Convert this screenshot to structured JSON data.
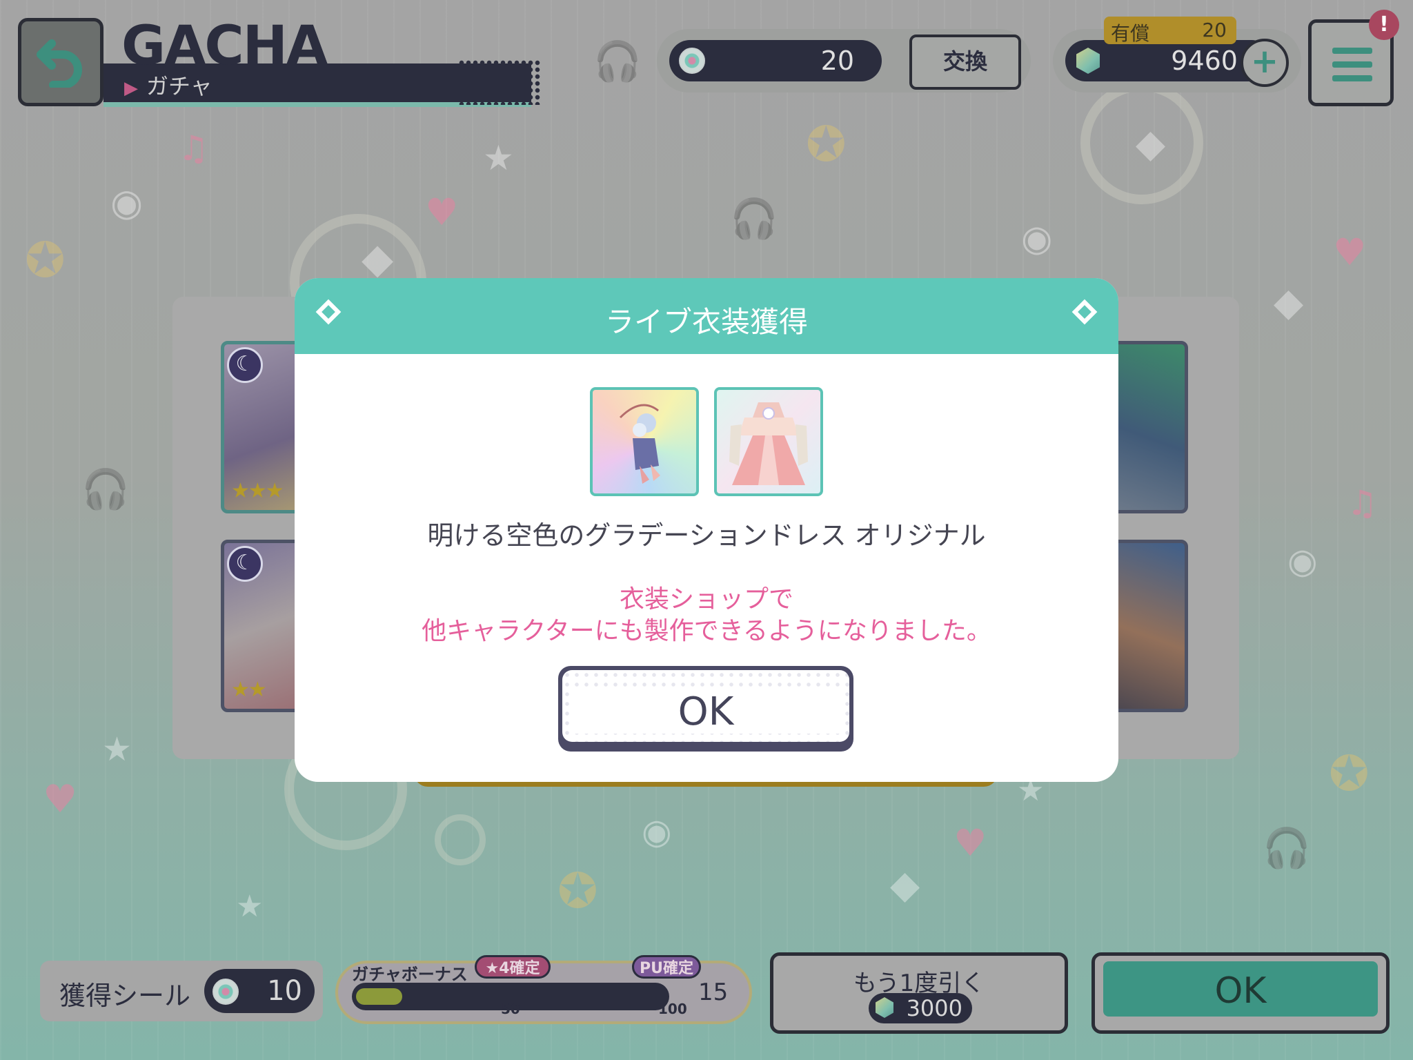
{
  "header": {
    "title_en": "GACHA",
    "title_jp": "ガチャ",
    "seal_count": "20",
    "exchange_label": "交換",
    "paid_label": "有償",
    "paid_count": "20",
    "crystal_count": "9460",
    "plus_label": "+",
    "alert_label": "!"
  },
  "modal": {
    "title": "ライブ衣装獲得",
    "item_name": "明ける空色のグラデーションドレス オリジナル",
    "note_line1": "衣装ショップで",
    "note_line2": "他キャラクターにも製作できるようになりました。",
    "ok_label": "OK"
  },
  "footer": {
    "seal_label": "獲得シール",
    "seal_count": "10",
    "bonus_label": "ガチャボーナス",
    "bonus_tag_4star": "★4確定",
    "bonus_tag_pu": "PU確定",
    "bonus_tick_50": "50",
    "bonus_tick_100": "100",
    "bonus_count": "15",
    "bonus_progress_fraction": 0.15,
    "redraw_label": "もう1度引く",
    "redraw_cost": "3000",
    "ok_label": "OK"
  },
  "colors": {
    "modal_header": "#5ec8b9",
    "accent_pink": "#e55f9b",
    "dark_navy": "#2b2d3e"
  }
}
